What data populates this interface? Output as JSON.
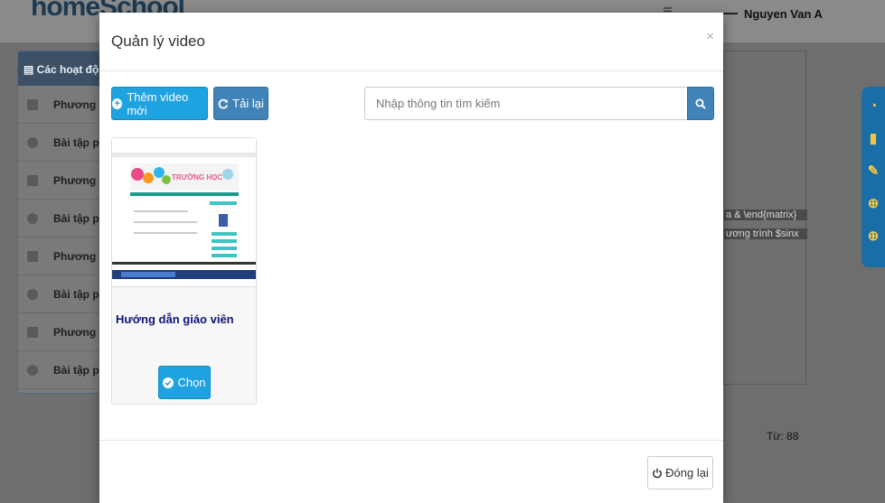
{
  "background": {
    "brand": "homeSchool",
    "user_name": "Nguyen Van A",
    "panel_header": "Các hoạt động",
    "rows": [
      {
        "label": "Phương trình"
      },
      {
        "label": "Bài tập phương trình"
      },
      {
        "label": "Phương trình"
      },
      {
        "label": "Bài tập phương trình"
      },
      {
        "label": "Phương trình"
      },
      {
        "label": "Bài tập phương trình"
      },
      {
        "label": "Phương trình"
      },
      {
        "label": "Bài tập phương trình"
      }
    ],
    "right_text_1": "a & \\end{matrix}",
    "right_text_2": "ương trình $sinx",
    "word_count": "Từ: 88",
    "float_icons": [
      "dashboard-icon",
      "book-icon",
      "edit-icon",
      "plus-circle-icon",
      "zoom-in-icon"
    ]
  },
  "modal": {
    "title": "Quản lý video",
    "close_symbol": "×",
    "add_label": "Thêm video mới",
    "reload_label": "Tải lại",
    "search_placeholder": "Nhập thông tin tìm kiếm",
    "videos": [
      {
        "title": "Hướng dẫn giáo viên",
        "choose_label": "Chọn",
        "thumb_brand": "TRƯỜNG HỌC"
      }
    ],
    "close_label": "Đóng lại"
  },
  "colors": {
    "primary": "#1fa2e0",
    "secondary": "#3f83b8",
    "title_link": "#12127a"
  }
}
